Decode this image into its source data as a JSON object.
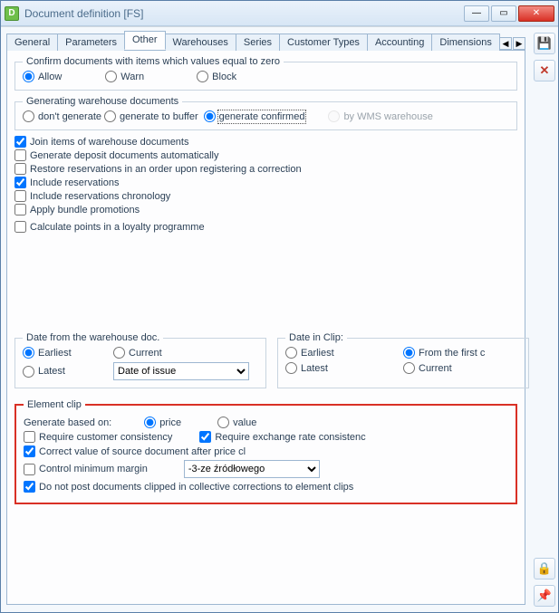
{
  "window": {
    "title": "Document definition [FS]"
  },
  "tabs": {
    "items": [
      "General",
      "Parameters",
      "Other",
      "Warehouses",
      "Series",
      "Customer Types",
      "Accounting",
      "Dimensions"
    ],
    "active": "Other"
  },
  "confirm_group": {
    "legend": "Confirm documents with items which values equal to zero",
    "allow": "Allow",
    "warn": "Warn",
    "block": "Block"
  },
  "gen_group": {
    "legend": "Generating warehouse documents",
    "dont": "don't generate",
    "to_buffer": "generate to buffer",
    "confirmed": "generate confirmed",
    "by_wms": "by WMS warehouse"
  },
  "checks": {
    "join": "Join items of warehouse documents",
    "deposit": "Generate deposit documents automatically",
    "restore": "Restore reservations in an order upon registering a correction",
    "include_res": "Include reservations",
    "include_chron": "Include reservations chronology",
    "bundle": "Apply bundle promotions",
    "loyalty": "Calculate points in a loyalty programme"
  },
  "date_wh": {
    "legend": "Date from the warehouse doc.",
    "earliest": "Earliest",
    "current": "Current",
    "latest": "Latest",
    "select_value": "Date of issue"
  },
  "date_clip": {
    "legend": "Date in Clip:",
    "earliest": "Earliest",
    "from_first": "From the first c",
    "latest": "Latest",
    "current": "Current"
  },
  "element_clip": {
    "legend": "Element clip",
    "gen_label": "Generate based on:",
    "price": "price",
    "value": "value",
    "req_customer": "Require customer consistency",
    "req_exch": "Require exchange rate consistenc",
    "correct_value": "Correct value of source document after price cl",
    "ctrl_margin": "Control minimum margin",
    "margin_select": "-3-ze źródłowego",
    "no_post": "Do not post documents clipped in collective corrections to element clips"
  },
  "icons": {
    "save": "💾",
    "cancel": "✕",
    "lock": "🔒",
    "pin": "📌",
    "left": "◀",
    "right": "▶"
  }
}
